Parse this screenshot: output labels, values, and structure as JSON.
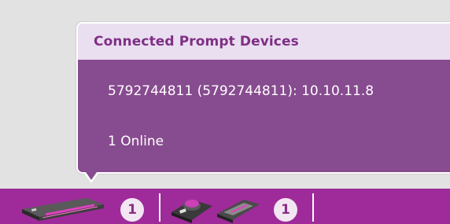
{
  "tooltip": {
    "title": "Connected Prompt Devices",
    "device_line": "5792744811 (5792744811): 10.10.11.8",
    "status_line": "1 Online"
  },
  "taskbar": {
    "groups": [
      {
        "icon": "prompt-device-hardware-icon",
        "count": "1"
      },
      {
        "icon": "prompt-controller-icon",
        "count": "1"
      }
    ]
  },
  "colors": {
    "accent": "#9e2b99",
    "header_bg": "#eadff0",
    "body_bg": "#874b8f",
    "title_text": "#7f2f86"
  }
}
